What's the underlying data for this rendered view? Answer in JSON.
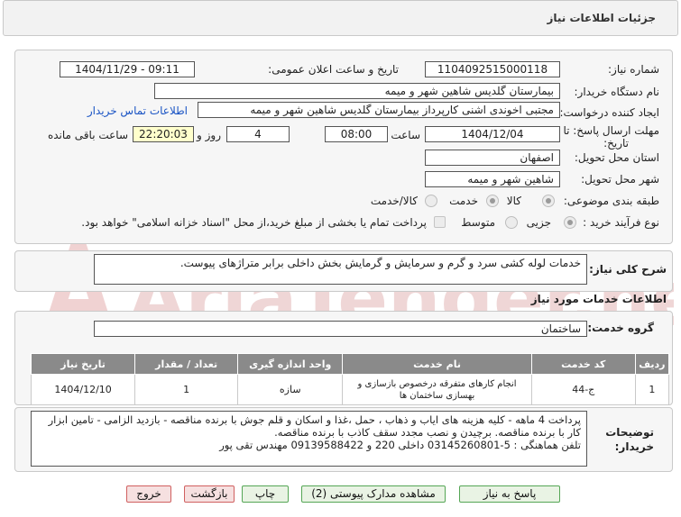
{
  "header": {
    "title": "جزئیات اطلاعات نیاز"
  },
  "details": {
    "need_number_label": "شماره نیاز:",
    "need_number": "1104092515000118",
    "announce_label": "تاریخ و ساعت اعلان عمومی:",
    "announce_value": "1404/11/29 - 09:11",
    "buyer_label": "نام دستگاه خریدار:",
    "buyer": "بیمارستان گلدیس  شاهین شهر و میمه",
    "creator_label": "ایجاد کننده درخواست:",
    "creator": "مجتبی اخوندی اشنی کارپرداز بیمارستان گلدیس  شاهین شهر و میمه",
    "contact_link": "اطلاعات تماس خریدار",
    "deadline_label_1": "مهلت ارسال پاسخ: تا",
    "deadline_label_2": "تاریخ:",
    "deadline_date": "1404/12/04",
    "time_label": "ساعت",
    "deadline_time": "08:00",
    "days_value": "4",
    "days_label": "روز و",
    "remaining_time": "22:20:03",
    "remaining_label": "ساعت باقی مانده",
    "province_label": "استان محل تحویل:",
    "province": "اصفهان",
    "city_label": "شهر محل تحویل:",
    "city": "شاهین شهر و میمه",
    "category_label": "طبقه بندی موضوعی:",
    "category_options": [
      "کالا",
      "خدمت",
      "کالا/خدمت"
    ],
    "process_label": "نوع فرآیند خرید :",
    "process_options": [
      "جزیی",
      "متوسط"
    ],
    "payment_note": "پرداخت تمام یا بخشی از مبلغ خرید،از محل \"اسناد خزانه اسلامی\" خواهد بود."
  },
  "summary": {
    "label": "شرح کلی نیاز:",
    "text": "خدمات لوله کشی سرد و گرم و سرمایش و گرمایش بخش داخلی برابر متراژهای پیوست."
  },
  "services": {
    "section_title": "اطلاعات خدمات مورد نیاز",
    "group_label": "گروه خدمت:",
    "group_value": "ساختمان",
    "columns": [
      "ردیف",
      "کد خدمت",
      "نام خدمت",
      "واحد اندازه گیری",
      "تعداد / مقدار",
      "تاریخ نیاز"
    ],
    "rows": [
      [
        "1",
        "ج-44",
        "انجام کارهای متفرقه درخصوص بازسازی و بهسازی ساختمان ها",
        "سازه",
        "1",
        "1404/12/10"
      ]
    ]
  },
  "notes": {
    "label_1": "توضیحات",
    "label_2": "خریدار:",
    "lines": [
      "پرداخت 4 ماهه - کلیه هزینه های ایاب و ذهاب ، حمل ،غذا و اسکان و قلم جوش با برنده مناقصه - بازدید الزامی - تامین ابزار",
      "کار با برنده مناقصه. برچیدن و نصب مجدد سقف کاذب با برنده مناقصه.",
      "تلفن هماهنگی : 5-03145260801 داخلی 220 و 09139588422 مهندس تقی پور"
    ]
  },
  "buttons": {
    "reply": "پاسخ به نیاز",
    "attachments": "مشاهده مدارک پیوستی (2)",
    "print": "چاپ",
    "back": "بازگشت",
    "exit": "خروج"
  },
  "watermark": {
    "text": "AriaTender.net"
  }
}
